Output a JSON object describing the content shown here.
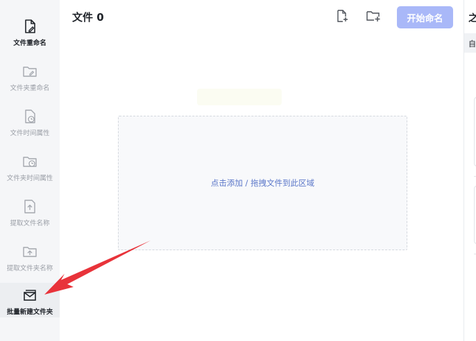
{
  "sidebar": {
    "items": [
      {
        "label": "文件重命名",
        "icon": "file-edit-icon",
        "state": "active"
      },
      {
        "label": "文件夹重命名",
        "icon": "folder-edit-icon",
        "state": "normal"
      },
      {
        "label": "文件时间属性",
        "icon": "file-clock-icon",
        "state": "normal"
      },
      {
        "label": "文件夹时间属性",
        "icon": "folder-clock-icon",
        "state": "normal"
      },
      {
        "label": "提取文件名称",
        "icon": "file-upload-icon",
        "state": "normal"
      },
      {
        "label": "提取文件夹名称",
        "icon": "folder-upload-icon",
        "state": "normal"
      },
      {
        "label": "批量新建文件夹",
        "icon": "folder-new-icon",
        "state": "selected"
      }
    ]
  },
  "main": {
    "title": "文件 0",
    "add_file_icon": "add-file-icon",
    "add_folder_icon": "add-folder-icon",
    "start_button_label": "开始命名",
    "dropzone_hint": "点击添加 / 拖拽文件到此区域"
  },
  "right_panel": {
    "glyph_top": "之",
    "glyph_mid": "自"
  },
  "colors": {
    "accent_disabled": "#a9b8f8",
    "link_blue": "#5b77c9",
    "annotation_red": "#e8333a"
  }
}
